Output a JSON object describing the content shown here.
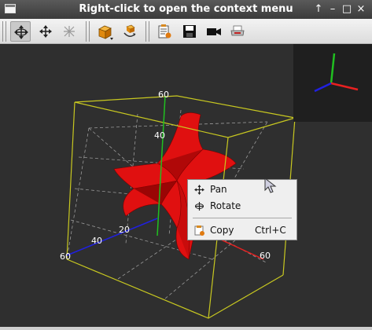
{
  "window": {
    "title": "Right-click to open the context menu",
    "buttons": {
      "pin": "↑",
      "minimize": "–",
      "maximize": "□",
      "close": "×"
    }
  },
  "toolbar": {
    "items": [
      {
        "name": "rotate-mode",
        "active": true
      },
      {
        "name": "pan-mode",
        "active": false
      },
      {
        "name": "zoom-mode",
        "active": false
      },
      {
        "name": "view-cube",
        "active": false
      },
      {
        "name": "reset-view",
        "active": false
      },
      {
        "name": "options",
        "active": false
      },
      {
        "name": "save",
        "active": false
      },
      {
        "name": "video",
        "active": false
      },
      {
        "name": "print",
        "active": false
      }
    ]
  },
  "axes_labels": {
    "z_top": "60",
    "z_mid": "40",
    "x_60": "60",
    "x_40": "40",
    "x_20": "20",
    "y_60": "60"
  },
  "colors": {
    "bbox": "#c8c820",
    "surface": "#e01010",
    "x_axis": "#e82020",
    "y_axis": "#20c020",
    "z_axis": "#2020e0"
  },
  "context_menu": {
    "items": [
      {
        "label": "Pan",
        "shortcut": ""
      },
      {
        "label": "Rotate",
        "shortcut": ""
      },
      {
        "label": "Copy",
        "shortcut": "Ctrl+C"
      }
    ]
  }
}
